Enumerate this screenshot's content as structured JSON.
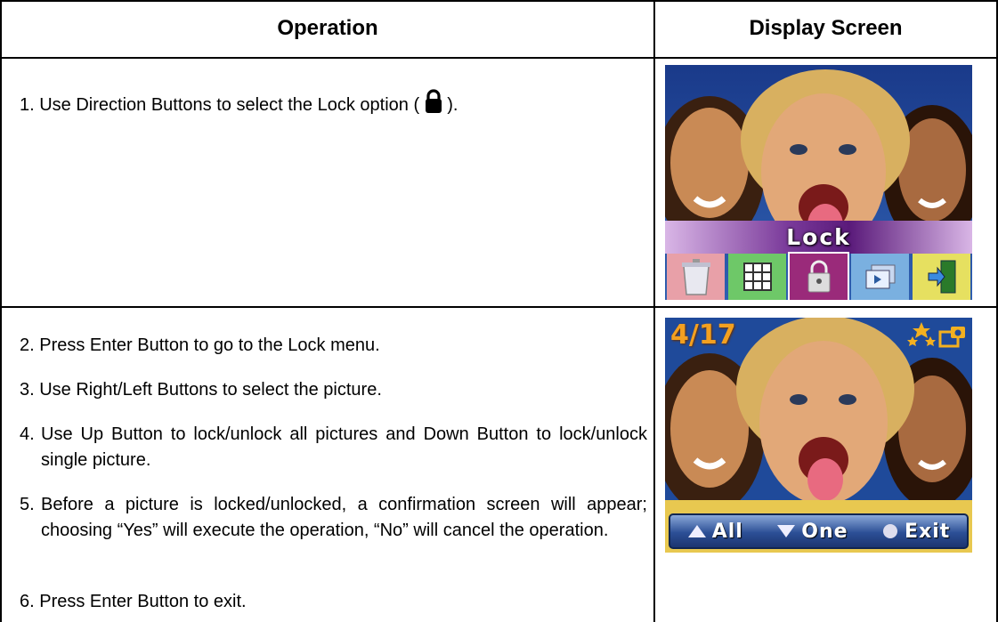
{
  "table": {
    "headers": {
      "operation": "Operation",
      "display": "Display Screen"
    }
  },
  "steps": [
    {
      "pre": "1. Use Direction Buttons to select the Lock option (",
      "post": ")."
    },
    {
      "text": "2. Press Enter Button to go to the Lock menu."
    },
    {
      "text": "3. Use Right/Left Buttons to select the picture."
    },
    {
      "num": "4.",
      "text": "Use Up Button to lock/unlock all pictures and Down Button to lock/unlock single picture."
    },
    {
      "num": "5.",
      "text": "Before a picture is locked/unlocked, a confirmation screen will appear; choosing “Yes” will execute the operation, “No” will cancel the operation."
    },
    {
      "text": "6. Press Enter Button to exit."
    }
  ],
  "screen1": {
    "menu_title": "Lock",
    "icons": [
      "trash-icon",
      "grid-icon",
      "lock-icon",
      "slideshow-icon",
      "exit-door-icon"
    ],
    "icon_colors": [
      "#e8a0a8",
      "#6ec868",
      "#9a2a7a",
      "#7ab0e0",
      "#e6e060"
    ]
  },
  "screen2": {
    "counter": "4/17",
    "controls": {
      "up": "All",
      "down": "One",
      "exit": "Exit"
    }
  },
  "colors": {
    "border": "#000000",
    "counter": "#f3a020",
    "menu_bar": "#7b3a9a"
  }
}
